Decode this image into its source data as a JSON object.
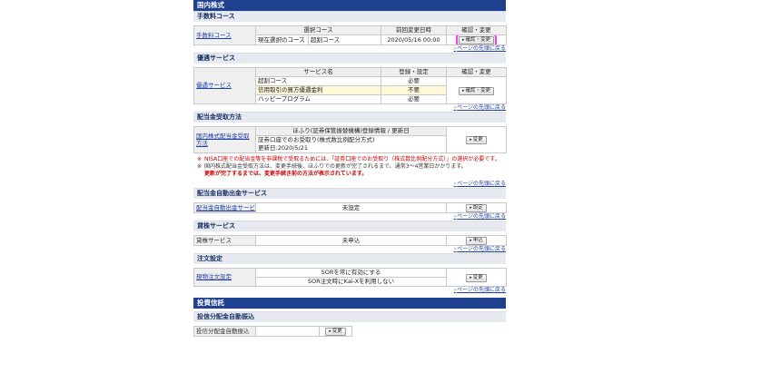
{
  "domestic_stock": {
    "header": "国内株式",
    "fee_course": {
      "section": "手数料コース",
      "row_label": "手数料コース",
      "col_course": "選択コース",
      "col_date": "前回変更日時",
      "col_action": "確認・変更",
      "current_label": "現在選択のコース",
      "current_value": "超割コース",
      "changed_at": "2020/05/16 00:00",
      "button": "確認・変更",
      "pagetop": "ページの先頭に戻る"
    },
    "preferential": {
      "section": "優遇サービス",
      "row_label": "優遇サービス",
      "col_service": "サービス名",
      "col_status": "登録・設定",
      "col_action": "確認・変更",
      "rows": [
        {
          "name": "超割コース",
          "status": "必要"
        },
        {
          "name": "信用取引の買方優遇金利",
          "status": "不要"
        },
        {
          "name": "ハッピープログラム",
          "status": "必要"
        }
      ],
      "button": "確認・変更",
      "pagetop": "ページの先頭に戻る"
    },
    "dividend": {
      "section": "配当金受取方法",
      "row_label": "国内株式配当金受取方法",
      "col_header": "ほふり(証券保管振替機構)登録情報 / 更新日",
      "value": "証券口座でのお受取り(株式数比例配分方式)",
      "updated": "更新日:2020/5/21",
      "button": "変更",
      "note1_mark": "※",
      "note1": "NISA口座での配当金等を非課税で受取るためには、「証券口座でのお受取り（株式数比例配分方式）」の選択が必要です。",
      "note2_mark": "※",
      "note2": "国内株式配当金受取方法は、変更手続後、ほふりでの更新が完了されるまで、通常3～4営業日かかります。",
      "note3": "更新が完了するまでは、変更手続き前の方法が表示されています。",
      "pagetop": "ページの先頭に戻る"
    },
    "auto_dividend": {
      "section": "配当金自動出金サービス",
      "row_label": "配当金自動出金サービス",
      "value": "未設定",
      "button": "設定",
      "pagetop": "ページの先頭に戻る"
    },
    "lending": {
      "section": "貸株サービス",
      "row_label": "貸株サービス",
      "value": "未申込",
      "button": "申込",
      "pagetop": "ページの先頭に戻る"
    },
    "order_settings": {
      "section": "注文設定",
      "row_label": "現物注文設定",
      "line1": "SORを常に有効にする",
      "line2": "SOR注文時にKai-Xを利用しない",
      "button": "変更",
      "pagetop": "ページの先頭に戻る"
    }
  },
  "investment_trust": {
    "header": "投資信託",
    "auto_reinvest": {
      "section": "投信分配金自動振込",
      "row_label": "投信分配金自動振込",
      "button": "変更"
    }
  },
  "colors": {
    "header_bg": "#1f3f8f",
    "section_bg": "#e6e9ef",
    "link": "#1d3ca8",
    "highlight": "#ff33ff",
    "warning": "#c80000"
  }
}
